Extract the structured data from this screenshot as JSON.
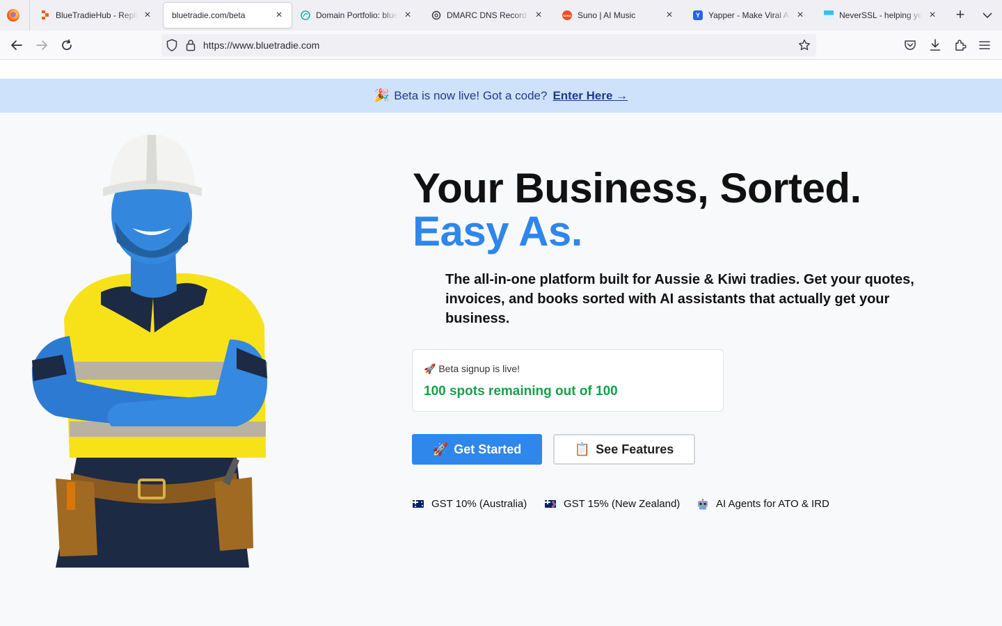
{
  "browser": {
    "tabs": [
      {
        "title": "BlueTradieHub - Replit",
        "favicon_color": "#f26207"
      },
      {
        "title": "bluetradie.com/beta",
        "active": true
      },
      {
        "title": "Domain Portfolio: bluetradie",
        "favicon_color": "#14b8a6"
      },
      {
        "title": "DMARC DNS Record Explained",
        "favicon_color": "#333333"
      },
      {
        "title": "Suno | AI Music",
        "favicon_color": "#f04e23",
        "favicon_text": "SUNO"
      },
      {
        "title": "Yapper - Make Viral AI Videos",
        "favicon_color": "#2563eb",
        "favicon_text": "Y"
      },
      {
        "title": "NeverSSL - helping you get online",
        "favicon_color": "#38bdf8"
      }
    ],
    "url": "https://www.bluetradie.com",
    "icons": [
      "back-icon",
      "forward-icon",
      "reload-icon",
      "shield-icon",
      "lock-icon",
      "bookmark-star-icon",
      "pocket-icon",
      "download-icon",
      "extensions-icon",
      "menu-icon",
      "new-tab-icon",
      "tab-list-icon"
    ]
  },
  "banner": {
    "emoji": "🎉",
    "text": "Beta is now live! Got a code?",
    "cta": "Enter Here →"
  },
  "hero": {
    "headline_line1": "Your Business, Sorted.",
    "headline_line2": "Easy As.",
    "subheadline": "The all-in-one platform built for Aussie & Kiwi tradies. Get your quotes, invoices, and books sorted with AI assistants that actually get your business.",
    "image_alt": "Smiling tradie in hard hat and hi-vis shirt with arms crossed"
  },
  "beta_card": {
    "emoji": "🚀",
    "label": "Beta signup is live!",
    "spots_text": "100 spots remaining out of 100",
    "spots_remaining": 100,
    "spots_total": 100
  },
  "buttons": {
    "primary_emoji": "🚀",
    "primary": "Get Started",
    "secondary_emoji": "📋",
    "secondary": "See Features"
  },
  "features": [
    {
      "icon": "australia-flag-icon",
      "text": "GST 10% (Australia)"
    },
    {
      "icon": "new-zealand-flag-icon",
      "text": "GST 15% (New Zealand)"
    },
    {
      "icon": "robot-icon",
      "text": "AI Agents for ATO & IRD"
    }
  ],
  "colors": {
    "accent": "#2f86eb",
    "banner_bg": "#cfe2fb",
    "banner_text": "#1e3a8a",
    "success": "#14a14a"
  }
}
